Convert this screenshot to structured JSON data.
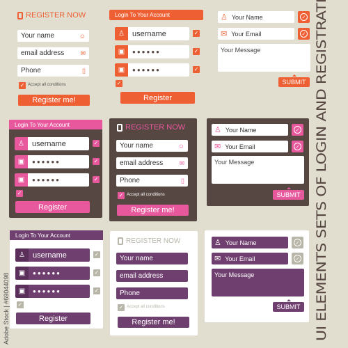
{
  "colors": {
    "background": "#e1ded0",
    "orange": "#ee5f33",
    "pink": "#e8589c",
    "brown": "#574742",
    "purple": "#6f3f6f",
    "grey": "#b8b5a9"
  },
  "side_title": "UI ELEMENTS SETS OF LOGIN AND REGISTRATION",
  "watermark": "Adobe Stock | #69044098",
  "register_forms": [
    {
      "theme": "orange",
      "title": "REGISTER NOW",
      "fields": [
        {
          "placeholder": "Your name",
          "icon": "smiley-icon"
        },
        {
          "placeholder": "email address",
          "icon": "envelope-icon"
        },
        {
          "placeholder": "Phone",
          "icon": "mobile-phone-icon"
        }
      ],
      "checkbox_label": "Accept all conditions",
      "checked": true,
      "button": "Register me!"
    },
    {
      "theme": "pink",
      "title": "REGISTER NOW",
      "fields": [
        {
          "placeholder": "Your name",
          "icon": "smiley-icon"
        },
        {
          "placeholder": "email address",
          "icon": "envelope-icon"
        },
        {
          "placeholder": "Phone",
          "icon": "mobile-phone-icon"
        }
      ],
      "checkbox_label": "Accept all conditions",
      "checked": true,
      "button": "Register me!"
    },
    {
      "theme": "purple",
      "title": "REGISTER NOW",
      "fields": [
        {
          "placeholder": "Your name"
        },
        {
          "placeholder": "email address"
        },
        {
          "placeholder": "Phone"
        }
      ],
      "checkbox_label": "Accept all conditions",
      "checked": true,
      "button": "Register me!"
    }
  ],
  "login_forms": [
    {
      "theme": "orange",
      "title": "Login To Your Account",
      "username": "username",
      "password": "●●●●●●",
      "confirm": "●●●●●●",
      "button": "Register"
    },
    {
      "theme": "pink",
      "title": "Login To Your Account",
      "username": "username",
      "password": "●●●●●●",
      "confirm": "●●●●●●",
      "button": "Register"
    },
    {
      "theme": "purple",
      "title": "Login To Your Account",
      "username": "username",
      "password": "●●●●●●",
      "confirm": "●●●●●●",
      "button": "Register"
    }
  ],
  "contact_forms": [
    {
      "theme": "orange",
      "name": "Your Name",
      "email": "Your Email",
      "message": "Your Message",
      "button": "SUBMIT"
    },
    {
      "theme": "pink",
      "name": "Your Name",
      "email": "Your Email",
      "message": "Your Message",
      "button": "SUBMIT"
    },
    {
      "theme": "purple",
      "name": "Your Name",
      "email": "Your Email",
      "message": "Your Message",
      "button": "SUBMIT"
    }
  ],
  "glyphs": {
    "check": "✓",
    "user": "♙",
    "lock": "🔒",
    "smiley": "☺",
    "envelope": "✉",
    "phone": "▯",
    "tag": "▮"
  }
}
